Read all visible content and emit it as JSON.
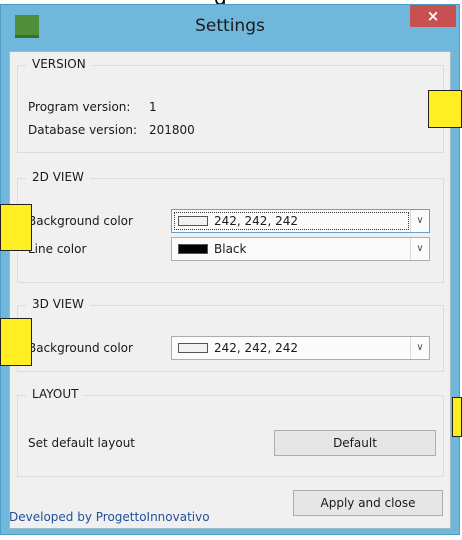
{
  "window": {
    "title": "Settings",
    "close_symbol": "×",
    "icon": "app-icon"
  },
  "header_fragment": "g",
  "version_group": {
    "title": "VERSION",
    "program_label": "Program version:",
    "program_value": "1",
    "database_label": "Database version:",
    "database_value": "201800"
  },
  "view2d_group": {
    "title": "2D VIEW",
    "background_label": "Background color",
    "background_value": "242, 242, 242",
    "background_swatch": "#f2f2f2",
    "line_label": "Line color",
    "line_value": "Black",
    "line_swatch": "#000000"
  },
  "view3d_group": {
    "title": "3D VIEW",
    "background_label": "Background color",
    "background_value": "242, 242, 242",
    "background_swatch": "#f2f2f2"
  },
  "layout_group": {
    "title": "LAYOUT",
    "label": "Set default layout",
    "button": "Default"
  },
  "footer": {
    "apply_button": "Apply and close",
    "developer_text": "Developed by ProgettoInnovativo"
  },
  "colors": {
    "titlebar": "#6fb8dc",
    "close": "#c75050",
    "link": "#1e4f9c",
    "annotation": "#ffee22"
  }
}
